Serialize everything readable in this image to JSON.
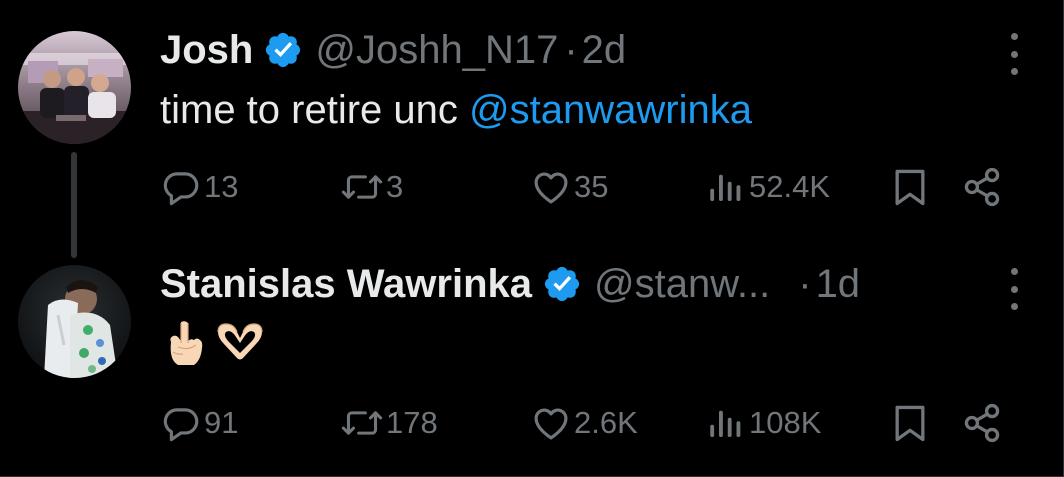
{
  "tweets": [
    {
      "name": "Josh",
      "handle": "@Joshh_N17",
      "separator": "·",
      "time": "2d",
      "text": "time to retire unc ",
      "mention": "@stanwawrinka",
      "replies": "13",
      "reposts": "3",
      "likes": "35",
      "views": "52.4K"
    },
    {
      "name": "Stanislas Wawrinka",
      "handle": "@stanw...",
      "separator": "·",
      "time": "1d",
      "emojis": [
        "middle-finger-emoji",
        "heart-hands-emoji"
      ],
      "replies": "91",
      "reposts": "178",
      "likes": "2.6K",
      "views": "108K"
    }
  ],
  "colors": {
    "background": "#000000",
    "text_primary": "#e7e9ea",
    "text_secondary": "#71767b",
    "accent": "#1d9bf0",
    "thread_line": "#333639"
  },
  "icons": {
    "reply": "reply-icon",
    "repost": "repost-icon",
    "like": "heart-icon",
    "views": "views-icon",
    "bookmark": "bookmark-icon",
    "share": "share-icon",
    "more": "more-icon",
    "verified": "verified-badge-icon"
  }
}
